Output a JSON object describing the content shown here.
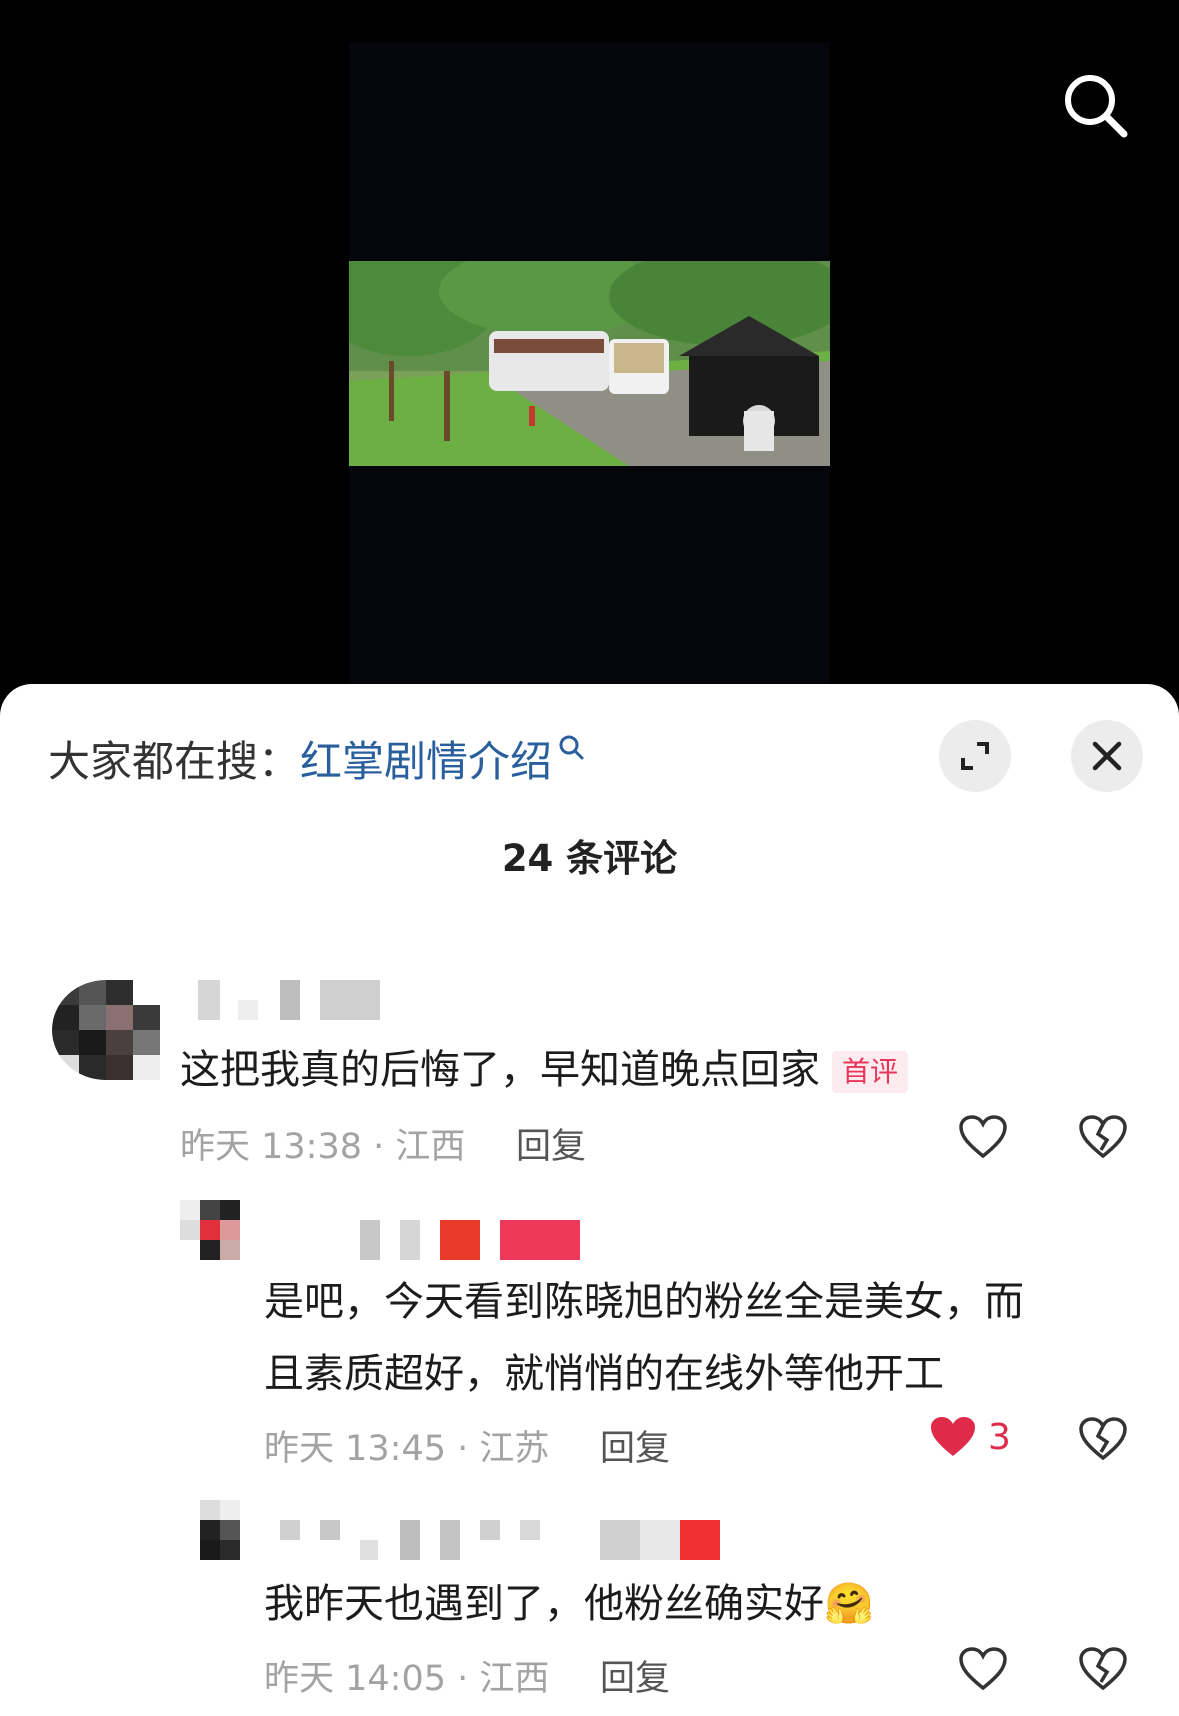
{
  "search": {
    "icon": "search-icon"
  },
  "trending": {
    "prefix": "大家都在搜：",
    "keyword": "红掌剧情介绍",
    "icon": "magnifier-small-icon"
  },
  "header": {
    "comment_count": "24 条评论"
  },
  "comments": [
    {
      "text": "这把我真的后悔了，早知道晚点回家",
      "tag": "首评",
      "time": "昨天 13:38 · 江西",
      "reply_label": "回复",
      "liked": false
    },
    {
      "text_line1": "是吧，今天看到陈晓旭的粉丝全是美女，而",
      "text_line2": "且素质超好，就悄悄的在线外等他开工",
      "time": "昨天 13:45 · 江苏",
      "reply_label": "回复",
      "likes": "3",
      "liked": true
    },
    {
      "text": "我昨天也遇到了，他粉丝确实好",
      "emoji": "🤗",
      "time": "昨天 14:05 · 江西",
      "reply_label": "回复",
      "liked": false
    }
  ],
  "colors": {
    "accent": "#e02a4a",
    "keyword": "#2a5f9e",
    "tag": "#e8365b"
  }
}
